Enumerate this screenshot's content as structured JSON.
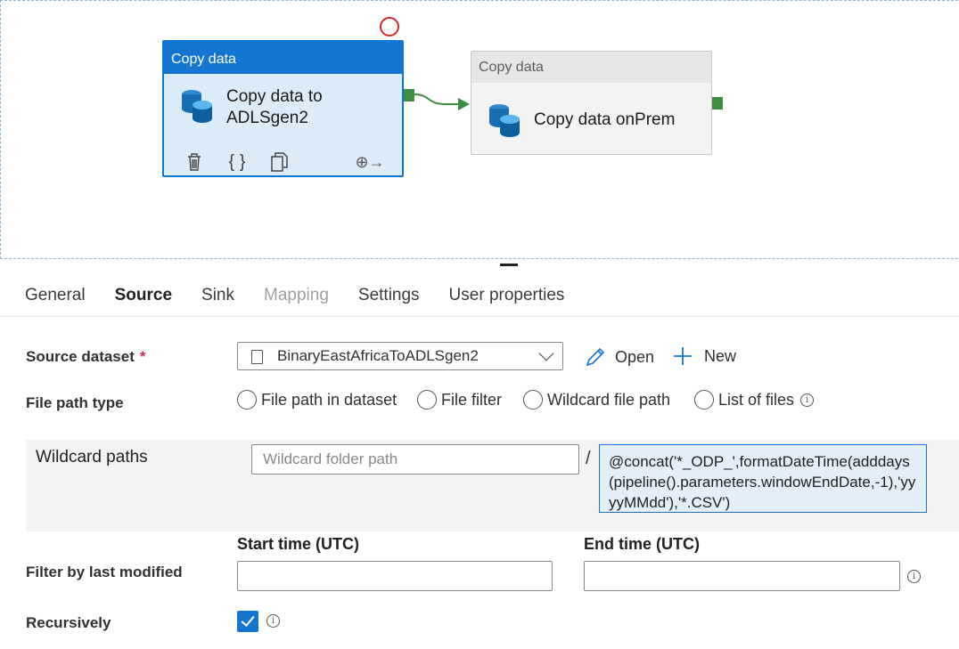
{
  "canvas": {
    "activities": [
      {
        "header": "Copy data",
        "name_line1": "Copy data to",
        "name_line2": "ADLSgen2"
      },
      {
        "header": "Copy data",
        "name_line1": "Copy data onPrem",
        "name_line2": ""
      }
    ],
    "tools": [
      "delete-icon",
      "code-icon",
      "clone-icon",
      "add-output-icon"
    ],
    "tool_glyphs": {
      "code": "{ }",
      "add_output": "⊕→"
    }
  },
  "tabs": [
    "General",
    "Source",
    "Sink",
    "Mapping",
    "Settings",
    "User properties"
  ],
  "active_tab": "Source",
  "source_dataset": {
    "label": "Source dataset",
    "required_mark": "*",
    "value": "BinaryEastAfricaToADLSgen2"
  },
  "actions": {
    "open": "Open",
    "new": "New"
  },
  "file_path_type": {
    "label": "File path type",
    "options": [
      "File path in dataset",
      "File filter",
      "Wildcard file path",
      "List of files"
    ]
  },
  "wildcard": {
    "label": "Wildcard paths",
    "folder_placeholder": "Wildcard folder path",
    "separator": "/",
    "file_expression": "@concat('*_ODP_',formatDateTime(adddays(pipeline().parameters.windowEndDate,-1),'yyyyMMdd'),'*.CSV')"
  },
  "filter": {
    "label": "Filter by last modified",
    "start_header": "Start time (UTC)",
    "end_header": "End time (UTC)"
  },
  "recursively": {
    "label": "Recursively",
    "checked": true
  },
  "info_glyph": "i",
  "colors": {
    "accent": "#1476d0",
    "port": "#3e8e41",
    "required": "#c4314b"
  }
}
